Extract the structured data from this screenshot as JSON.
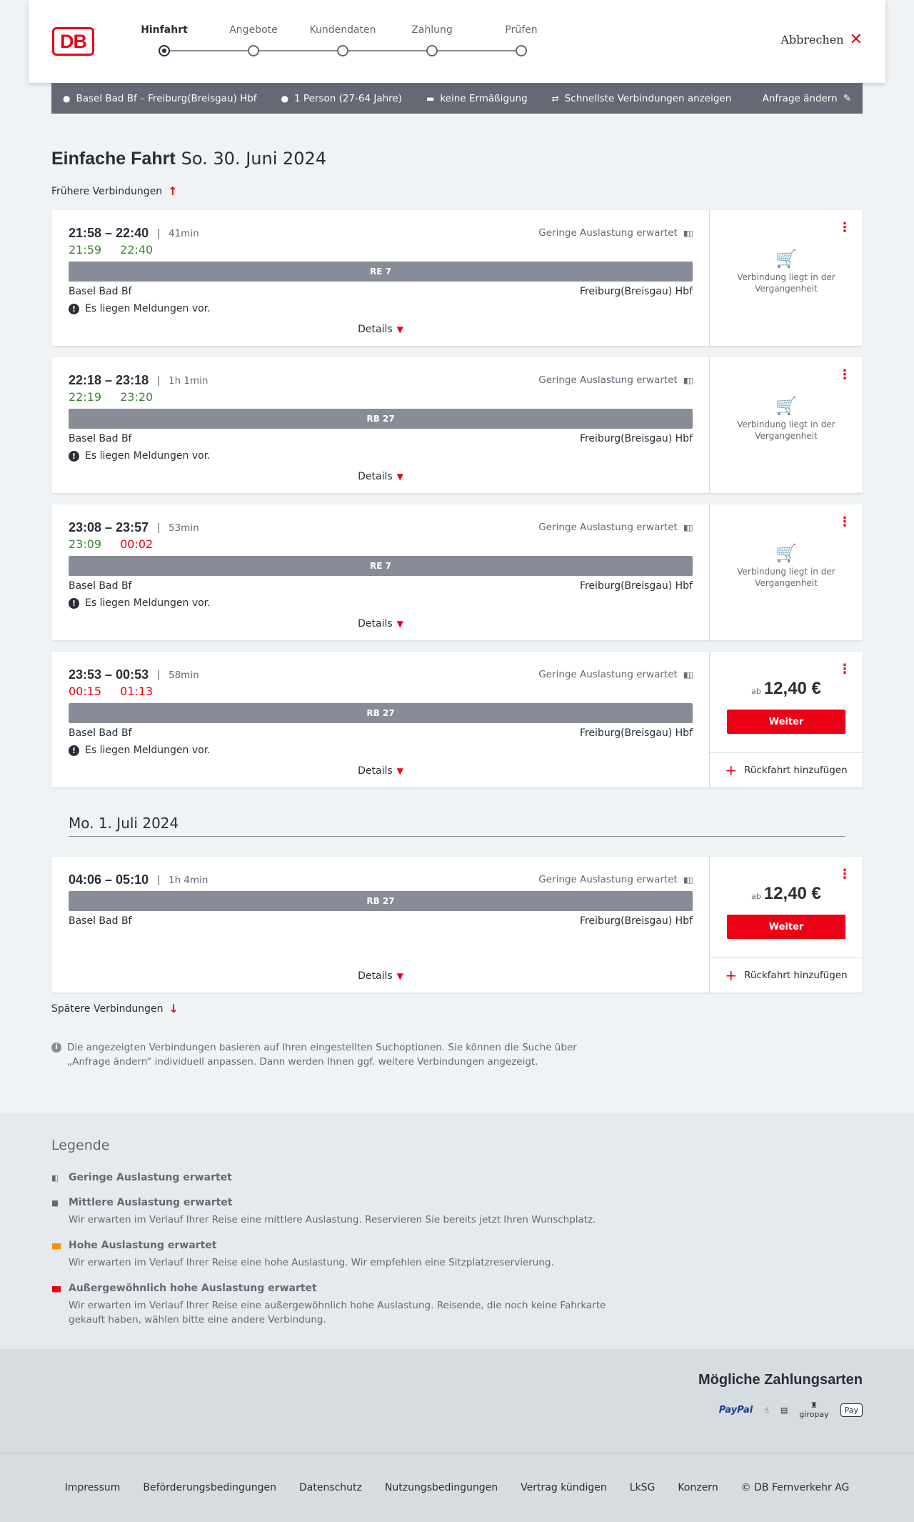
{
  "header": {
    "logo": "DB",
    "steps": [
      "Hinfahrt",
      "Angebote",
      "Kundendaten",
      "Zahlung",
      "Prüfen"
    ],
    "cancel_label": "Abbrechen"
  },
  "search": {
    "route": "Basel Bad Bf – Freiburg(Breisgau) Hbf",
    "passengers": "1 Person (27-64 Jahre)",
    "discount": "keine Ermäßigung",
    "fastest": "Schnellste Verbindungen anzeigen",
    "edit": "Anfrage ändern"
  },
  "title": {
    "bold": "Einfache Fahrt",
    "date": "So. 30. Juni 2024"
  },
  "earlier": "Frühere Verbindungen",
  "later": "Spätere Verbindungen",
  "connections": [
    {
      "times": "21:58 – 22:40",
      "duration": "41min",
      "rt_dep": "21:59",
      "rt_arr": "22:40",
      "train": "RE 7",
      "from": "Basel Bad Bf",
      "to": "Freiburg(Breisgau) Hbf",
      "load": "Geringe Auslastung erwartet",
      "message": "Es liegen Meldungen vor.",
      "details": "Details",
      "past": "Verbindung liegt in der Vergangenheit"
    },
    {
      "times": "22:18 – 23:18",
      "duration": "1h 1min",
      "rt_dep": "22:19",
      "rt_arr": "23:20",
      "train": "RB 27",
      "from": "Basel Bad Bf",
      "to": "Freiburg(Breisgau) Hbf",
      "load": "Geringe Auslastung erwartet",
      "message": "Es liegen Meldungen vor.",
      "details": "Details",
      "past": "Verbindung liegt in der Vergangenheit"
    },
    {
      "times": "23:08 – 23:57",
      "duration": "53min",
      "rt_dep": "23:09",
      "rt_arr": "00:02",
      "train": "RE 7",
      "from": "Basel Bad Bf",
      "to": "Freiburg(Breisgau) Hbf",
      "load": "Geringe Auslastung erwartet",
      "message": "Es liegen Meldungen vor.",
      "details": "Details",
      "past": "Verbindung liegt in der Vergangenheit"
    },
    {
      "times": "23:53 – 00:53",
      "duration": "58min",
      "rt_dep": "00:15",
      "rt_arr": "01:13",
      "train": "RB 27",
      "from": "Basel Bad Bf",
      "to": "Freiburg(Breisgau) Hbf",
      "load": "Geringe Auslastung erwartet",
      "message": "Es liegen Meldungen vor.",
      "details": "Details",
      "price_prefix": "ab",
      "price": "12,40 €",
      "button": "Weiter",
      "return": "Rückfahrt hinzufügen"
    },
    {
      "times": "04:06 – 05:10",
      "duration": "1h 4min",
      "train": "RB 27",
      "from": "Basel Bad Bf",
      "to": "Freiburg(Breisgau) Hbf",
      "load": "Geringe Auslastung erwartet",
      "details": "Details",
      "price_prefix": "ab",
      "price": "12,40 €",
      "button": "Weiter",
      "return": "Rückfahrt hinzufügen"
    }
  ],
  "date_separator": "Mo. 1. Juli 2024",
  "info": "Die angezeigten Verbindungen basieren auf Ihren eingestellten Suchoptionen. Sie können die Suche über „Anfrage ändern“ individuell anpassen. Dann werden Ihnen ggf. weitere Verbindungen angezeigt.",
  "legend": {
    "title": "Legende",
    "items": [
      {
        "title": "Geringe Auslastung erwartet",
        "desc": "",
        "color": "#646973"
      },
      {
        "title": "Mittlere Auslastung erwartet",
        "desc": "Wir erwarten im Verlauf Ihrer Reise eine mittlere Auslastung. Reservieren Sie bereits jetzt Ihren Wunschplatz.",
        "color": "#646973"
      },
      {
        "title": "Hohe Auslastung erwartet",
        "desc": "Wir erwarten im Verlauf Ihrer Reise eine hohe Auslastung. Wir empfehlen eine Sitzplatzreservierung.",
        "color": "#f39200"
      },
      {
        "title": "Außergewöhnlich hohe Auslastung erwartet",
        "desc": "Wir erwarten im Verlauf Ihrer Reise eine außergewöhnlich hohe Auslastung. Reisende, die noch keine Fahrkarte gekauft haben, wählen bitte eine andere Verbindung.",
        "color": "#ec0016"
      }
    ]
  },
  "payments": {
    "title": "Mögliche Zahlungsarten",
    "methods": [
      "PayPal",
      "giropay",
      "Pay"
    ]
  },
  "footer": [
    "Impressum",
    "Beförderungsbedingungen",
    "Datenschutz",
    "Nutzungsbedingungen",
    "Vertrag kündigen",
    "LkSG",
    "Konzern",
    "© DB Fernverkehr AG"
  ],
  "colors": {
    "accent": "#ec0016",
    "ontime": "#408335",
    "delayed": "#ec0016",
    "bar": "#878c96"
  }
}
